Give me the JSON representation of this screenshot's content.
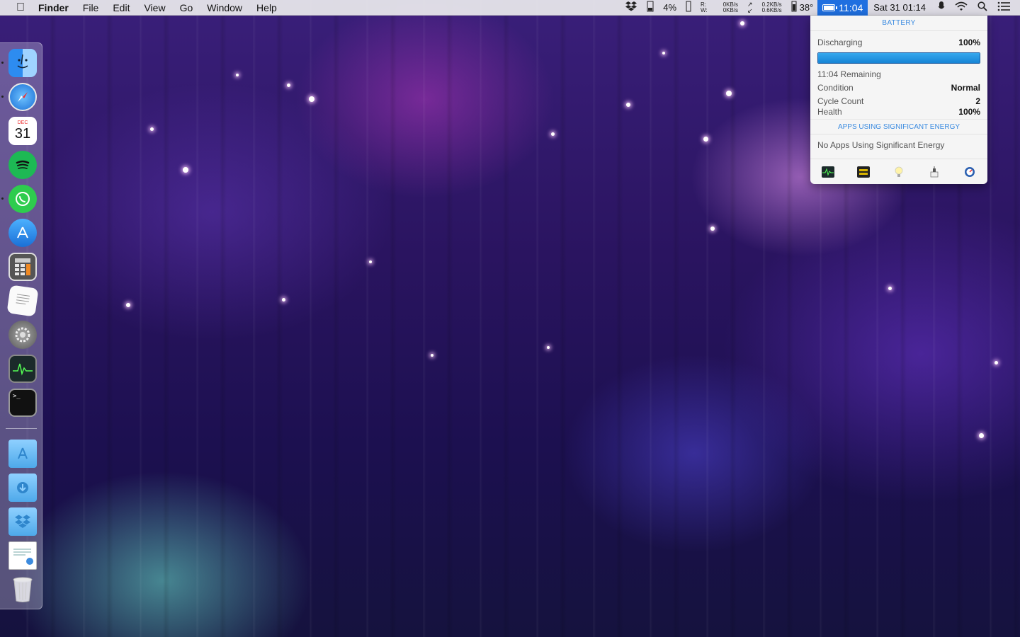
{
  "menubar": {
    "app_name": "Finder",
    "menus": [
      "File",
      "Edit",
      "View",
      "Go",
      "Window",
      "Help"
    ],
    "status": {
      "cpu": "4%",
      "disk_r_label": "R:",
      "disk_w_label": "W:",
      "net_up_1": "0KB/s",
      "net_down_1": "0KB/s",
      "net_up_2": "0.2KB/s",
      "net_down_2": "0.6KB/s",
      "temperature": "38°",
      "battery_time": "11:04",
      "clock": "Sat 31 01:14"
    }
  },
  "battery_popover": {
    "header": "BATTERY",
    "state_label": "Discharging",
    "state_value": "100%",
    "charge_fraction": 1.0,
    "remaining": "11:04 Remaining",
    "condition_label": "Condition",
    "condition_value": "Normal",
    "cycle_label": "Cycle Count",
    "cycle_value": "2",
    "health_label": "Health",
    "health_value": "100%",
    "apps_header": "APPS USING SIGNIFICANT ENERGY",
    "apps_empty": "No Apps Using Significant Energy"
  },
  "dock": {
    "items": [
      "finder",
      "safari",
      "calendar",
      "spotify",
      "whatsapp",
      "app-store",
      "calculator",
      "textedit",
      "system-preferences",
      "activity-monitor",
      "terminal",
      "applications-folder",
      "downloads-folder",
      "dropbox-folder",
      "preview-document",
      "trash"
    ],
    "calendar_month": "DEC",
    "calendar_day": "31"
  },
  "colors": {
    "accent": "#1f6fe0",
    "popover_link": "#3b8be0"
  }
}
